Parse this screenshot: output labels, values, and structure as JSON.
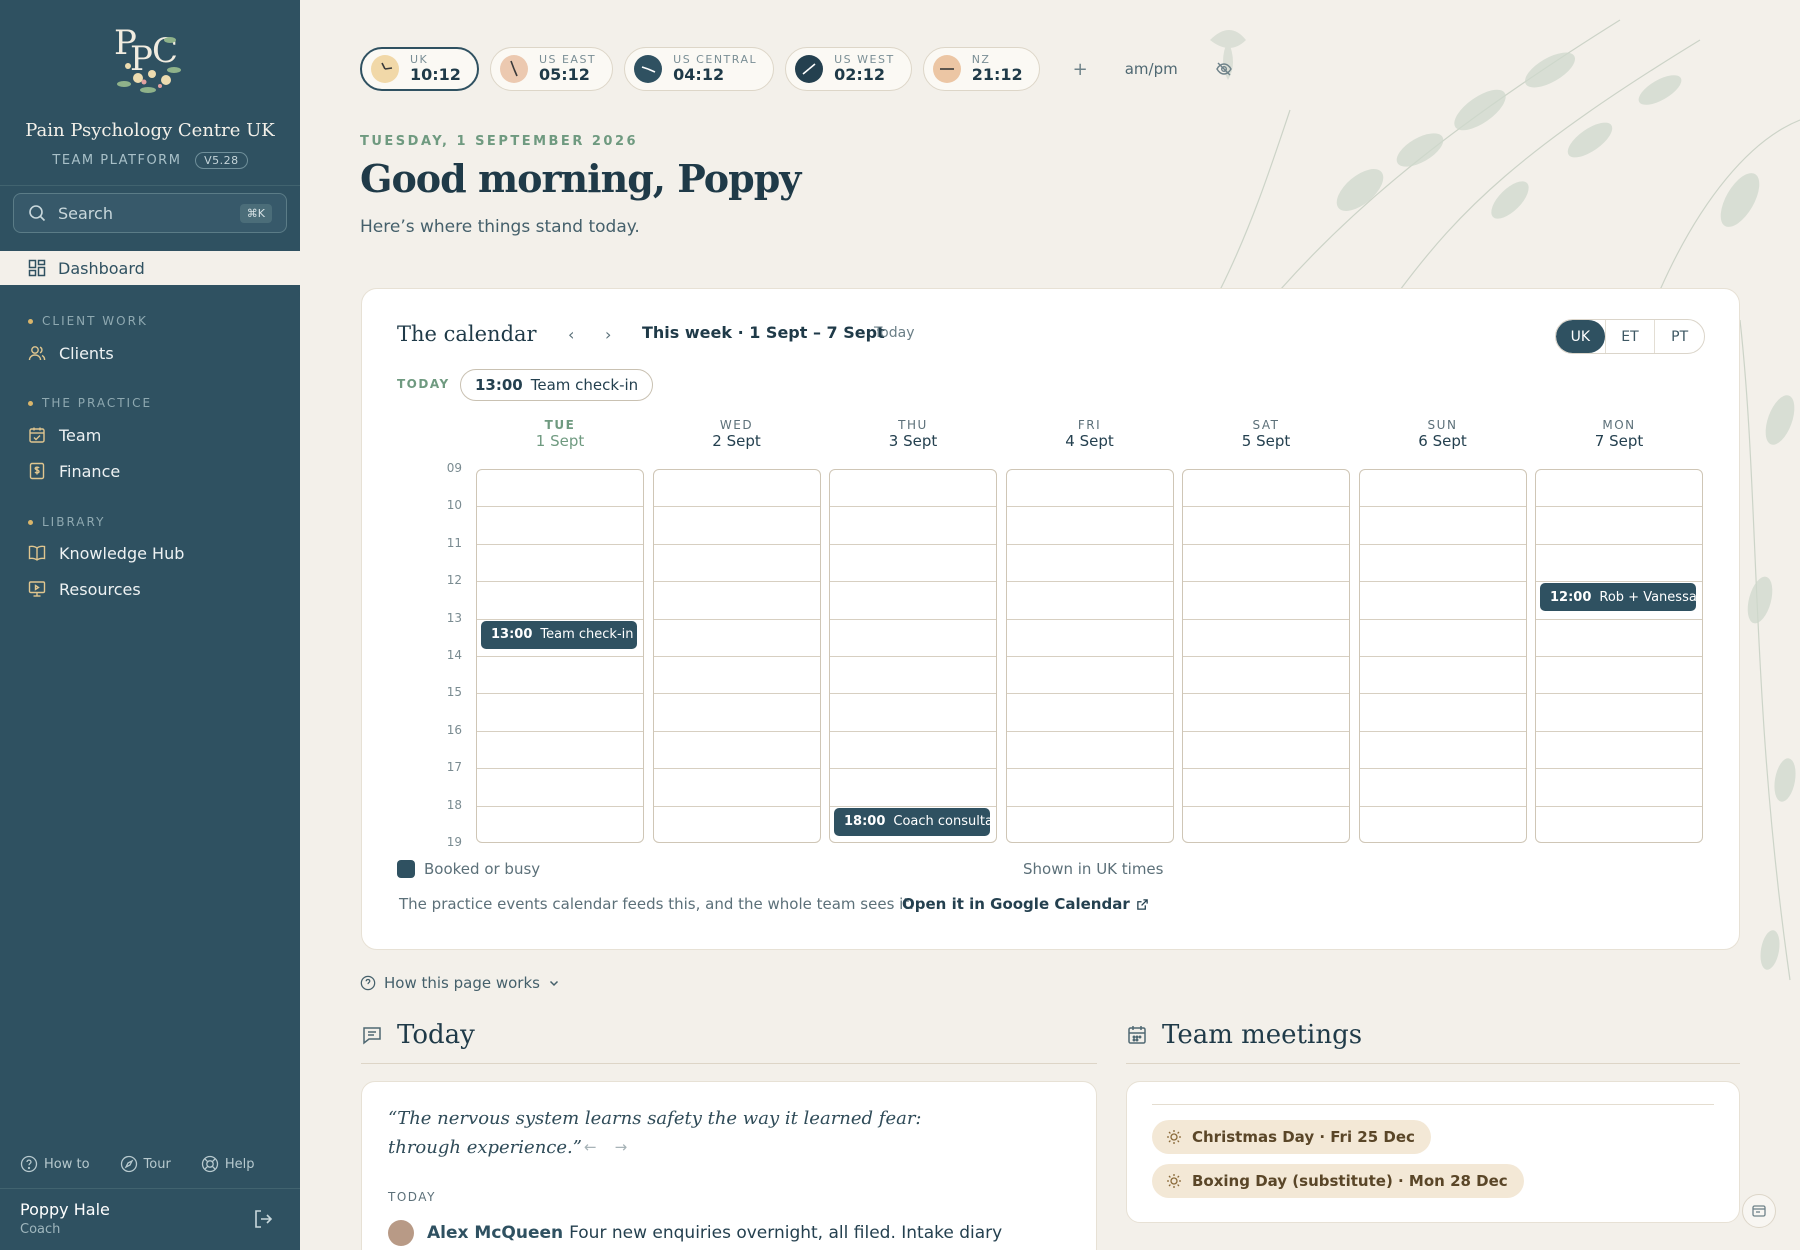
{
  "sidebar": {
    "org_name": "Pain Psychology Centre UK",
    "platform_label": "TEAM PLATFORM",
    "version": "V5.28",
    "search_placeholder": "Search",
    "search_shortcut": "⌘K",
    "active_item": "Dashboard",
    "sections": [
      {
        "label": "CLIENT WORK",
        "items": [
          {
            "label": "Clients",
            "icon": "users-icon"
          }
        ]
      },
      {
        "label": "THE PRACTICE",
        "items": [
          {
            "label": "Team",
            "icon": "calendar-check-icon"
          },
          {
            "label": "Finance",
            "icon": "dollar-doc-icon"
          }
        ]
      },
      {
        "label": "LIBRARY",
        "items": [
          {
            "label": "Knowledge Hub",
            "icon": "book-icon"
          },
          {
            "label": "Resources",
            "icon": "monitor-icon"
          }
        ]
      }
    ],
    "bottom_links": [
      "How to",
      "Tour",
      "Help"
    ],
    "user": {
      "name": "Poppy Hale",
      "role": "Coach"
    }
  },
  "clocks": {
    "zones": [
      {
        "tz": "UK",
        "time": "10:12",
        "selected": true
      },
      {
        "tz": "US EAST",
        "time": "05:12"
      },
      {
        "tz": "US CENTRAL",
        "time": "04:12"
      },
      {
        "tz": "US WEST",
        "time": "02:12"
      },
      {
        "tz": "NZ",
        "time": "21:12"
      }
    ],
    "add_label": "+",
    "ampm_label": "am/pm"
  },
  "header": {
    "date": "TUESDAY, 1 SEPTEMBER 2026",
    "greeting": "Good morning, Poppy",
    "subtitle": "Here’s where things stand today."
  },
  "calendar": {
    "title": "The calendar",
    "range": "This week · 1 Sept – 7 Sept",
    "today_button": "Today",
    "tz_options": [
      "UK",
      "ET",
      "PT"
    ],
    "tz_selected": "UK",
    "today_label": "TODAY",
    "today_event": {
      "time": "13:00",
      "title": "Team check-in"
    },
    "days": [
      {
        "dow": "TUE",
        "date": "1 Sept",
        "current": true
      },
      {
        "dow": "WED",
        "date": "2 Sept"
      },
      {
        "dow": "THU",
        "date": "3 Sept"
      },
      {
        "dow": "FRI",
        "date": "4 Sept"
      },
      {
        "dow": "SAT",
        "date": "5 Sept"
      },
      {
        "dow": "SUN",
        "date": "6 Sept"
      },
      {
        "dow": "MON",
        "date": "7 Sept"
      }
    ],
    "hours": [
      "09",
      "10",
      "11",
      "12",
      "13",
      "14",
      "15",
      "16",
      "17",
      "18",
      "19"
    ],
    "events": [
      {
        "day": 0,
        "start": 13,
        "time": "13:00",
        "title": "Team check-in"
      },
      {
        "day": 2,
        "start": 18,
        "time": "18:00",
        "title": "Coach consultation"
      },
      {
        "day": 6,
        "start": 12,
        "time": "12:00",
        "title": "Rob + Vanessa:"
      }
    ],
    "legend": "Booked or busy",
    "shown_in": "Shown in UK times",
    "feed_note": "The practice events calendar feeds this, and the whole team sees it.",
    "open_link": "Open it in Google Calendar"
  },
  "howto": "How this page works",
  "today_section": {
    "title": "Today",
    "quote_line1": "“The nervous system learns safety the way it learned fear:",
    "quote_line2": "through experience.”",
    "sub_label": "TODAY",
    "entry_name": "Alex McQueen",
    "entry_text": "Four new enquiries overnight, all filed. Intake diary"
  },
  "meetings_section": {
    "title": "Team meetings",
    "holidays": [
      "Christmas Day · Fri 25 Dec",
      "Boxing Day (substitute) · Mon 28 Dec"
    ]
  },
  "colors": {
    "sidebar": "#2f5161",
    "accent_green": "#6f9a80",
    "holiday_bg": "#f3e8d6",
    "page_bg": "#f3f0ea"
  }
}
